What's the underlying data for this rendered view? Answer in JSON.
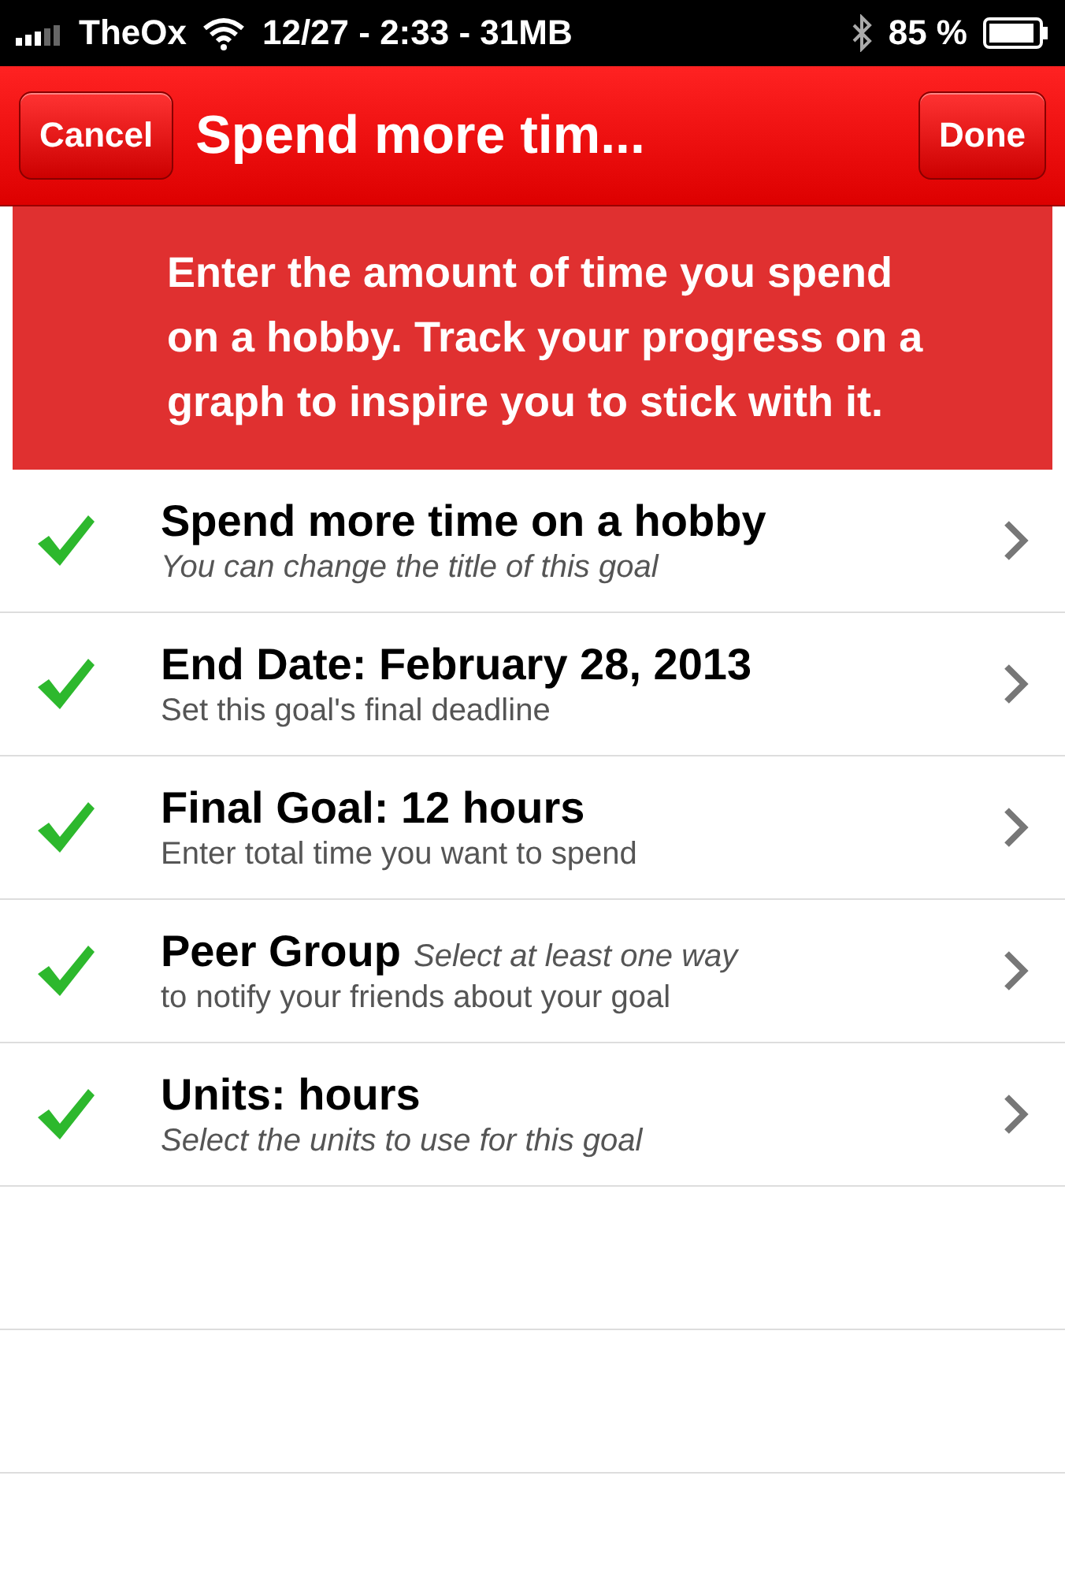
{
  "status_bar": {
    "carrier": "TheOx",
    "center": "12/27 - 2:33 - 31MB",
    "battery": "85 %"
  },
  "nav_bar": {
    "left_button": "Cancel",
    "title": "Spend more tim...",
    "right_button": "Done"
  },
  "description": "Enter the amount of time you spend on a hobby. Track your progress on a graph to inspire you to stick with it.",
  "rows": [
    {
      "kind": "stacked",
      "title": "Spend more time on a hobby",
      "subtitle": "You can change the title of this goal",
      "italic": true,
      "checked": true
    },
    {
      "kind": "stacked",
      "title": "End Date: February 28, 2013",
      "subtitle": "Set this goal's final deadline",
      "italic": false,
      "checked": true
    },
    {
      "kind": "stacked",
      "title": "Final Goal: 12 hours",
      "subtitle": "Enter total time you want to spend",
      "italic": false,
      "checked": true
    },
    {
      "kind": "inline",
      "title": "Peer Group",
      "subtitle": "Select at least one way",
      "subtitle_2": "to notify your friends about your goal",
      "italic": true,
      "checked": true
    },
    {
      "kind": "stacked",
      "title": "Units: hours",
      "subtitle": "Select the units to use for this goal",
      "italic": true,
      "checked": true
    }
  ]
}
